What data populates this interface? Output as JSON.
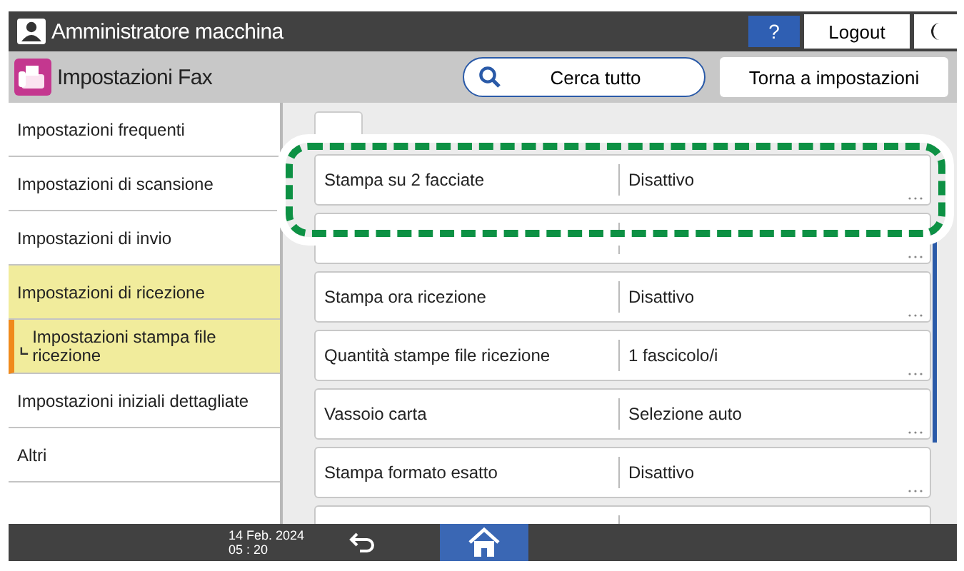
{
  "top_bar": {
    "user": "Amministratore macchina",
    "help": "?",
    "logout": "Logout"
  },
  "title_bar": {
    "title": "Impostazioni Fax",
    "search": "Cerca tutto",
    "back": "Torna a impostazioni"
  },
  "sidebar": {
    "items": [
      {
        "label": "Impostazioni frequenti",
        "selected": false
      },
      {
        "label": "Impostazioni di scansione",
        "selected": false
      },
      {
        "label": "Impostazioni di invio",
        "selected": false
      },
      {
        "label": "Impostazioni di ricezione",
        "selected": true,
        "children": [
          {
            "label": "Impostazioni stampa file ricezione",
            "selected": true
          }
        ]
      },
      {
        "label": "Impostazioni iniziali dettagliate",
        "selected": false
      },
      {
        "label": "Altri",
        "selected": false
      }
    ]
  },
  "settings": [
    {
      "kind": "row",
      "label": "Stampa su 2 facciate",
      "value": "Disattivo"
    },
    {
      "kind": "covered"
    },
    {
      "kind": "row",
      "label": "Stampa ora ricezione",
      "value": "Disattivo"
    },
    {
      "kind": "row",
      "label": "Quantità stampe file ricezione",
      "value": "1 fascicolo/i"
    },
    {
      "kind": "row",
      "label": "Vassoio carta",
      "value": "Selezione auto"
    },
    {
      "kind": "row",
      "label": "Stampa formato esatto",
      "value": "Disattivo"
    },
    {
      "kind": "covered"
    }
  ],
  "status_bar": {
    "date": "14 Feb. 2024",
    "time": "05 : 20"
  }
}
